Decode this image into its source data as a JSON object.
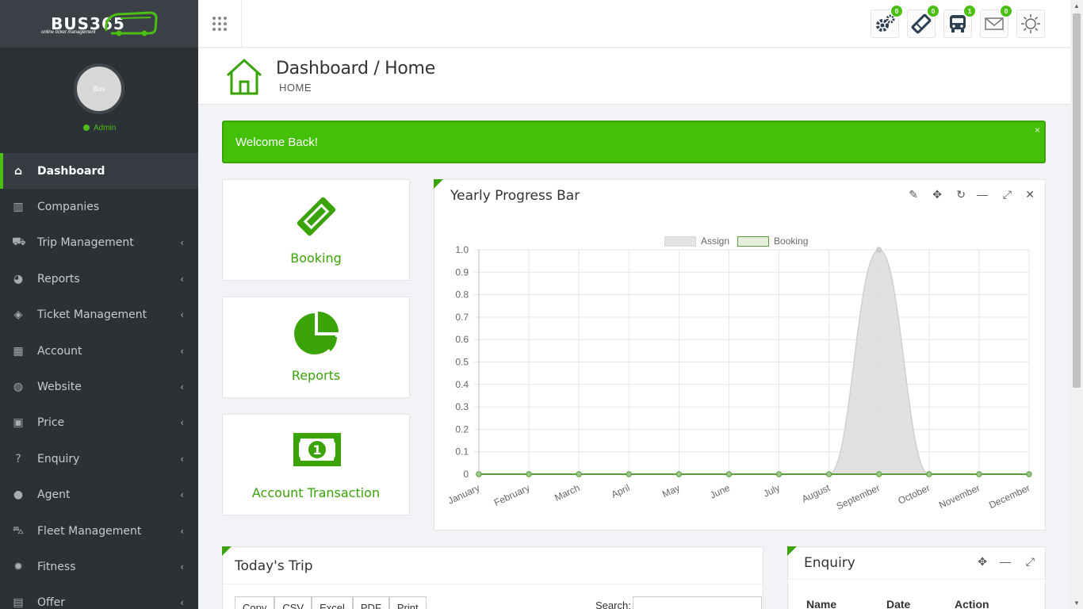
{
  "brand": {
    "logo": "BUS365",
    "tagline": "online ticket management"
  },
  "user": {
    "avatar_text": "Bus",
    "role": "Admin"
  },
  "sidebar": {
    "items": [
      {
        "label": "Dashboard",
        "icon": "home-icon"
      },
      {
        "label": "Companies",
        "icon": "building-icon"
      },
      {
        "label": "Trip Management",
        "icon": "road-icon"
      },
      {
        "label": "Reports",
        "icon": "pie-chart-icon"
      },
      {
        "label": "Ticket Management",
        "icon": "ticket-icon"
      },
      {
        "label": "Account",
        "icon": "calculator-icon"
      },
      {
        "label": "Website",
        "icon": "globe-icon"
      },
      {
        "label": "Price",
        "icon": "money-icon"
      },
      {
        "label": "Enquiry",
        "icon": "question-icon"
      },
      {
        "label": "Agent",
        "icon": "user-icon"
      },
      {
        "label": "Fleet Management",
        "icon": "car-icon"
      },
      {
        "label": "Fitness",
        "icon": "gear-icon"
      },
      {
        "label": "Offer",
        "icon": "gift-icon"
      }
    ]
  },
  "topbar": {
    "badges": {
      "settings": "0",
      "ticket": "0",
      "bus": "1",
      "mail": "0"
    }
  },
  "header": {
    "title": "Dashboard / Home",
    "breadcrumb": "HOME"
  },
  "alert": {
    "message": "Welcome Back!",
    "close": "×"
  },
  "cards": [
    {
      "label": "Booking",
      "icon": "ticket-icon"
    },
    {
      "label": "Reports",
      "icon": "pie-chart-icon"
    },
    {
      "label": "Account Transaction",
      "icon": "money-bill-icon"
    }
  ],
  "yearly_panel": {
    "title": "Yearly Progress Bar"
  },
  "todays_trip": {
    "title": "Today's Trip",
    "buttons": [
      "Copy",
      "CSV",
      "Excel",
      "PDF",
      "Print"
    ],
    "search_label": "Search:"
  },
  "enquiry": {
    "title": "Enquiry",
    "columns": [
      "Name",
      "Date",
      "Action"
    ]
  },
  "colors": {
    "accent": "#4cbf14",
    "sidebar": "#2c3136"
  },
  "chart_data": {
    "type": "area",
    "categories": [
      "January",
      "February",
      "March",
      "April",
      "May",
      "June",
      "July",
      "August",
      "September",
      "October",
      "November",
      "December"
    ],
    "series": [
      {
        "name": "Assign",
        "values": [
          0,
          0,
          0,
          0,
          0,
          0,
          0,
          0,
          1,
          0,
          0,
          0
        ],
        "color": "#dcdcdc"
      },
      {
        "name": "Booking",
        "values": [
          0,
          0,
          0,
          0,
          0,
          0,
          0,
          0,
          0,
          0,
          0,
          0
        ],
        "color": "#5a9e3a"
      }
    ],
    "y_ticks": [
      "0",
      "0.1",
      "0.2",
      "0.3",
      "0.4",
      "0.5",
      "0.6",
      "0.7",
      "0.8",
      "0.9",
      "1.0"
    ],
    "ylim": [
      0,
      1
    ],
    "legend": "top-center",
    "grid": true
  }
}
